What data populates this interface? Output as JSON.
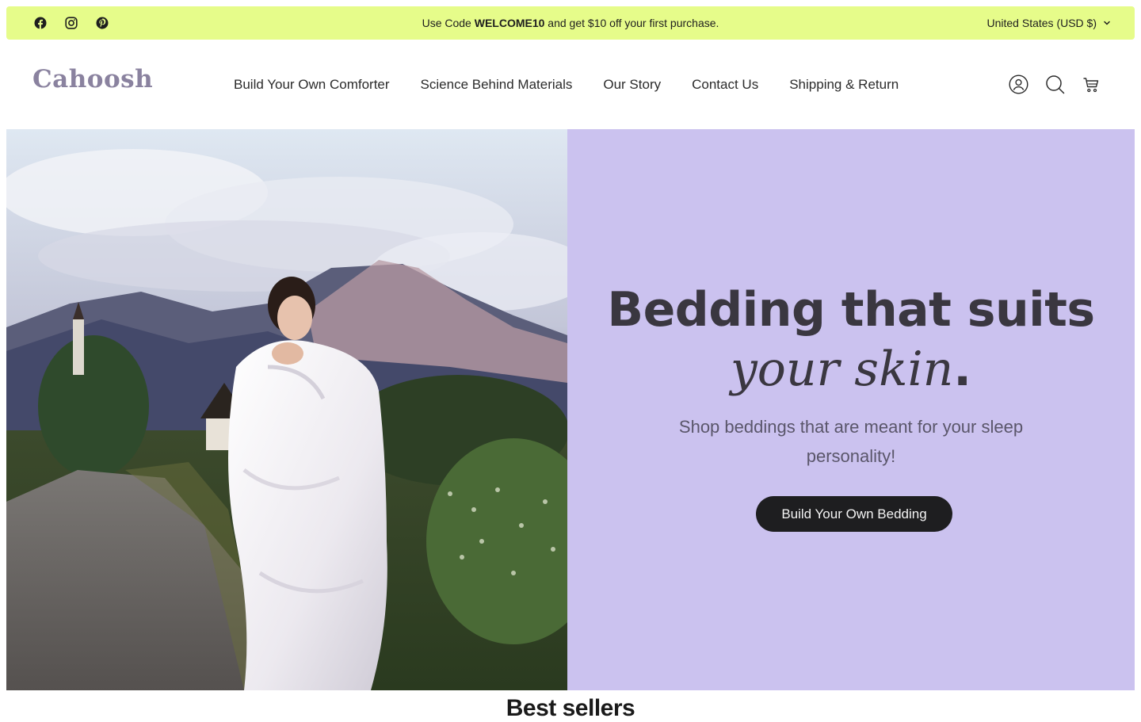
{
  "announcement": {
    "promo_prefix": "Use Code ",
    "promo_code": "WELCOME10",
    "promo_suffix": " and get $10 off your first purchase.",
    "currency": "United States (USD $)",
    "socials": [
      "facebook-icon",
      "instagram-icon",
      "pinterest-icon"
    ],
    "background": "#e6fc8a"
  },
  "header": {
    "logo": "Cahoosh",
    "logo_color": "#8a829f",
    "nav": [
      {
        "label": "Build Your Own Comforter"
      },
      {
        "label": "Science Behind Materials"
      },
      {
        "label": "Our Story"
      },
      {
        "label": "Contact Us"
      },
      {
        "label": "Shipping & Return"
      }
    ],
    "icons": [
      "account-icon",
      "search-icon",
      "cart-icon"
    ]
  },
  "hero": {
    "headline": "Bedding that suits",
    "headline_italic": "your skin",
    "headline_period": ".",
    "subtext": "Shop beddings that are meant for your sleep personality!",
    "cta": "Build Your Own Bedding",
    "panel_color": "#cbc2ef",
    "button_color": "#1e1e20"
  },
  "section": {
    "title": "Best sellers"
  }
}
